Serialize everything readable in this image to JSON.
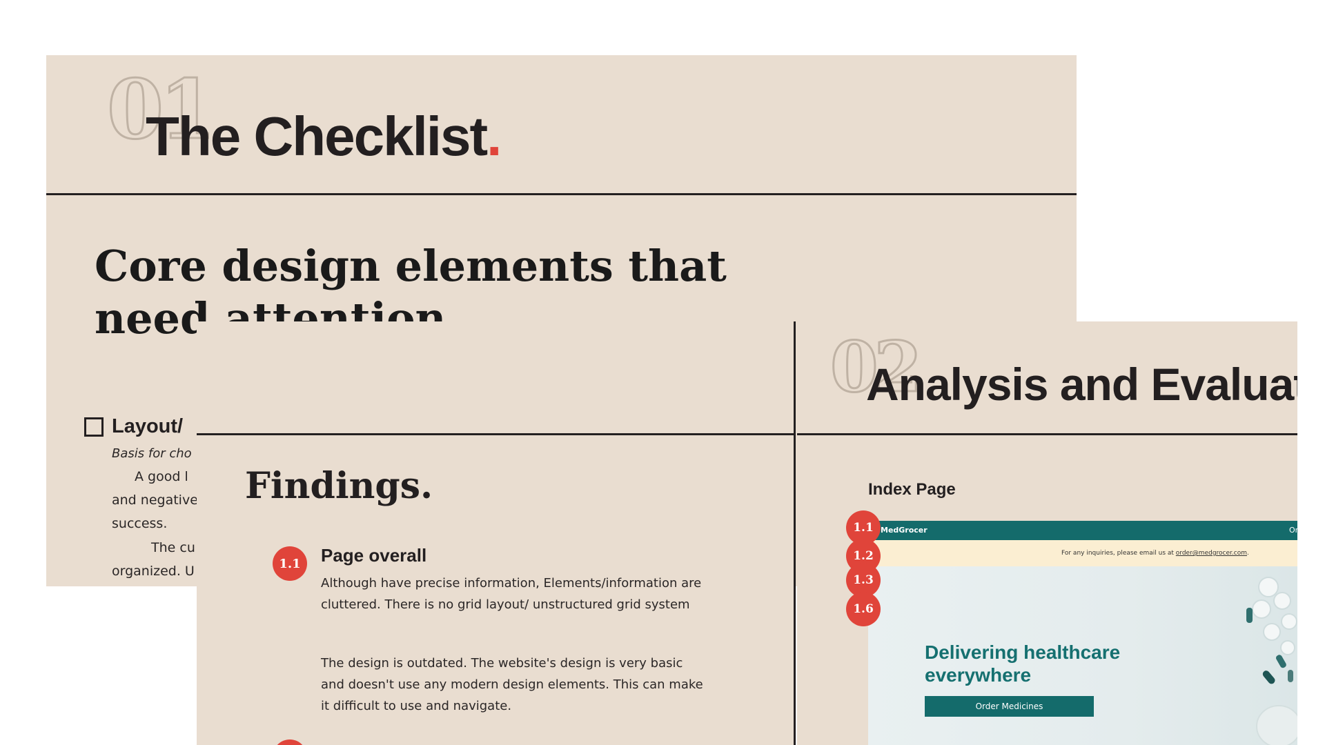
{
  "checklist": {
    "number": "01",
    "title": "The Checklist",
    "title_dot": ".",
    "core_heading": "Core design elements that need attention",
    "checkbox_label": "Layout/",
    "basis_text": "Basis for cho",
    "para_lines": [
      "A good l",
      "and negative",
      "success.",
      "The cu",
      "organized. U"
    ]
  },
  "findings": {
    "title": "Findings.",
    "item_badge": "1.1",
    "item_heading": "Page overall",
    "item_text_1": "Although have precise information, Elements/information are cluttered. There is no grid layout/ unstructured grid system",
    "item_text_2": "The design is outdated. The website's design is very basic and doesn't use any modern design elements. This can make it difficult to use and navigate."
  },
  "analysis": {
    "number": "02",
    "title": "Analysis and Evaluat",
    "index_label": "Index Page",
    "badges": [
      "1.1",
      "1.2",
      "1.3",
      "1.6"
    ],
    "mock": {
      "logo": "MedGrocer",
      "nav_right": "Order",
      "banner_text": "For any inquiries, please email us at ",
      "banner_email": "order@medgrocer.com",
      "banner_end": ".",
      "hero_heading": "Delivering healthcare everywhere",
      "hero_button": "Order Medicines"
    }
  },
  "colors": {
    "panel_bg": "#e9ddd0",
    "accent_red": "#e0443a",
    "brand_teal": "#146b6b",
    "banner_cream": "#fbeed2",
    "text_dark": "#231f20"
  }
}
